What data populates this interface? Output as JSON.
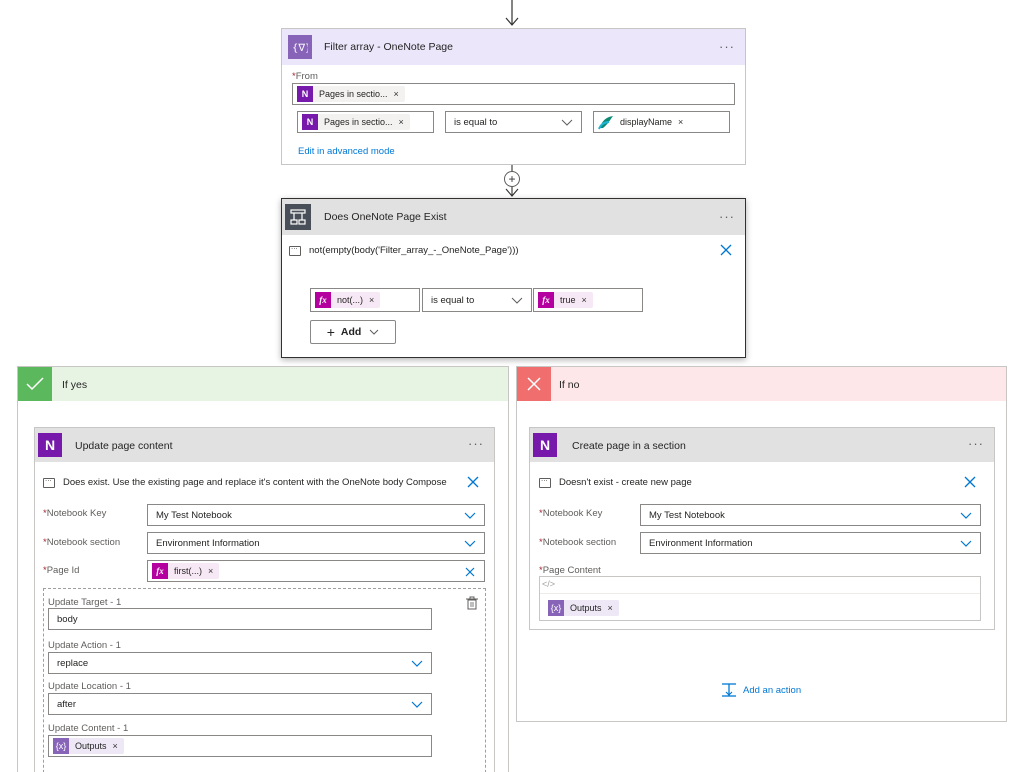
{
  "filter": {
    "title": "Filter array - OneNote Page",
    "menu": "···",
    "from_label": "From",
    "required_mark": "*",
    "from_token": "Pages in sectio...",
    "cond_left_token": "Pages in sectio...",
    "operator": "is equal to",
    "cond_right_token": "displayName",
    "edit_link": "Edit in advanced mode",
    "token_close": "×"
  },
  "condition": {
    "title": "Does OneNote Page Exist",
    "menu": "···",
    "comment": "not(empty(body('Filter_array_-_OneNote_Page')))",
    "left_token": "not(...)",
    "operator": "is equal to",
    "right_token": "true",
    "add_label": "Add",
    "token_close": "×"
  },
  "yes_branch": {
    "label": "If yes",
    "action_title": "Update page content",
    "menu": "···",
    "comment": "Does exist. Use the existing page and replace it's content with the OneNote body Compose",
    "fields": [
      {
        "label": "Notebook Key",
        "value": "My Test Notebook"
      },
      {
        "label": "Notebook section",
        "value": "Environment Information"
      },
      {
        "label": "Page Id",
        "token": "first(...)"
      }
    ],
    "sub": [
      {
        "label": "Update Target - 1",
        "value": "body"
      },
      {
        "label": "Update Action - 1",
        "value": "replace"
      },
      {
        "label": "Update Location - 1",
        "value": "after"
      },
      {
        "label": "Update Content - 1",
        "token": "Outputs"
      }
    ],
    "token_close": "×"
  },
  "no_branch": {
    "label": "If no",
    "action_title": "Create page in a section",
    "menu": "···",
    "comment": "Doesn't exist - create new page",
    "fields": [
      {
        "label": "Notebook Key",
        "value": "My Test Notebook"
      },
      {
        "label": "Notebook section",
        "value": "Environment Information"
      }
    ],
    "page_content_label": "Page Content",
    "code_glyph": "</>",
    "content_token": "Outputs",
    "add_action": "Add an action",
    "token_close": "×"
  },
  "icons": {
    "onenote_letter": "N",
    "fx_letter": "fx",
    "var_glyph": "{x}",
    "plus": "+",
    "check": "✓",
    "close": "✕"
  },
  "colors": {
    "filter_header": "#ece6fb",
    "filter_icon": "#8764b8",
    "condition_header": "#e1e1e2",
    "condition_icon": "#484f58",
    "yes_header": "#e7f4e4",
    "yes_icon": "#5cb85c",
    "no_header": "#fde7e9",
    "no_icon": "#f06e6e",
    "onenote": "#7719aa",
    "fx": "#b4009e",
    "link": "#0078d4"
  }
}
